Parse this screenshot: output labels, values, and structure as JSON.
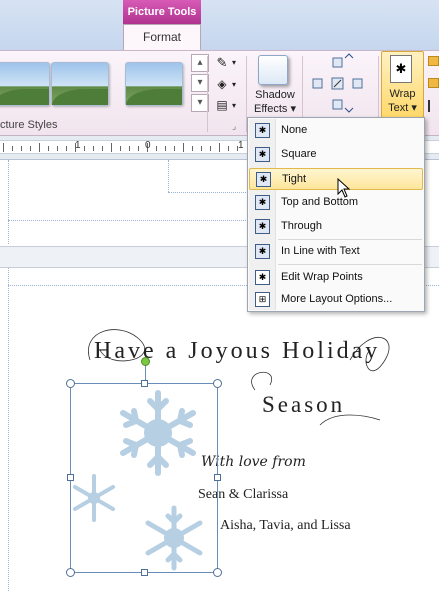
{
  "ribbon": {
    "contextual_tab_group": "Picture Tools",
    "active_tab": "Format",
    "picture_styles_group_label": "cture Styles",
    "shadow_effects": {
      "line1": "Shadow",
      "line2": "Effects ▾"
    },
    "wrap_text": {
      "line1": "Wrap",
      "line2": "Text ▾"
    }
  },
  "ruler": {
    "labels": [
      "1",
      "0",
      "1"
    ]
  },
  "wrap_menu": {
    "items": [
      {
        "label": "None",
        "icon": "wrap-none-icon",
        "highlighted": false
      },
      {
        "label": "Square",
        "icon": "wrap-square-icon",
        "highlighted": false
      },
      {
        "label": "Tight",
        "icon": "wrap-tight-icon",
        "highlighted": true
      },
      {
        "label": "Top and Bottom",
        "icon": "wrap-top-bottom-icon",
        "highlighted": false
      },
      {
        "label": "Through",
        "icon": "wrap-through-icon",
        "highlighted": false
      },
      {
        "label": "In Line with Text",
        "icon": "wrap-inline-icon",
        "highlighted": false
      },
      {
        "label": "Edit Wrap Points",
        "icon": "edit-wrap-points-icon",
        "highlighted": false
      },
      {
        "label": "More Layout Options...",
        "icon": "layout-options-icon",
        "highlighted": false
      }
    ]
  },
  "document": {
    "title_line1": "Have a Joyous Holiday",
    "title_line2": "Season",
    "with_love": "With love from",
    "names_line1": "Sean & Clarissa",
    "names_line2": "Aisha, Tavia, and Lissa"
  },
  "colors": {
    "contextual_tab": "#c040a0",
    "highlight": "#fde69b",
    "snowflake": "#b7cfe2"
  }
}
